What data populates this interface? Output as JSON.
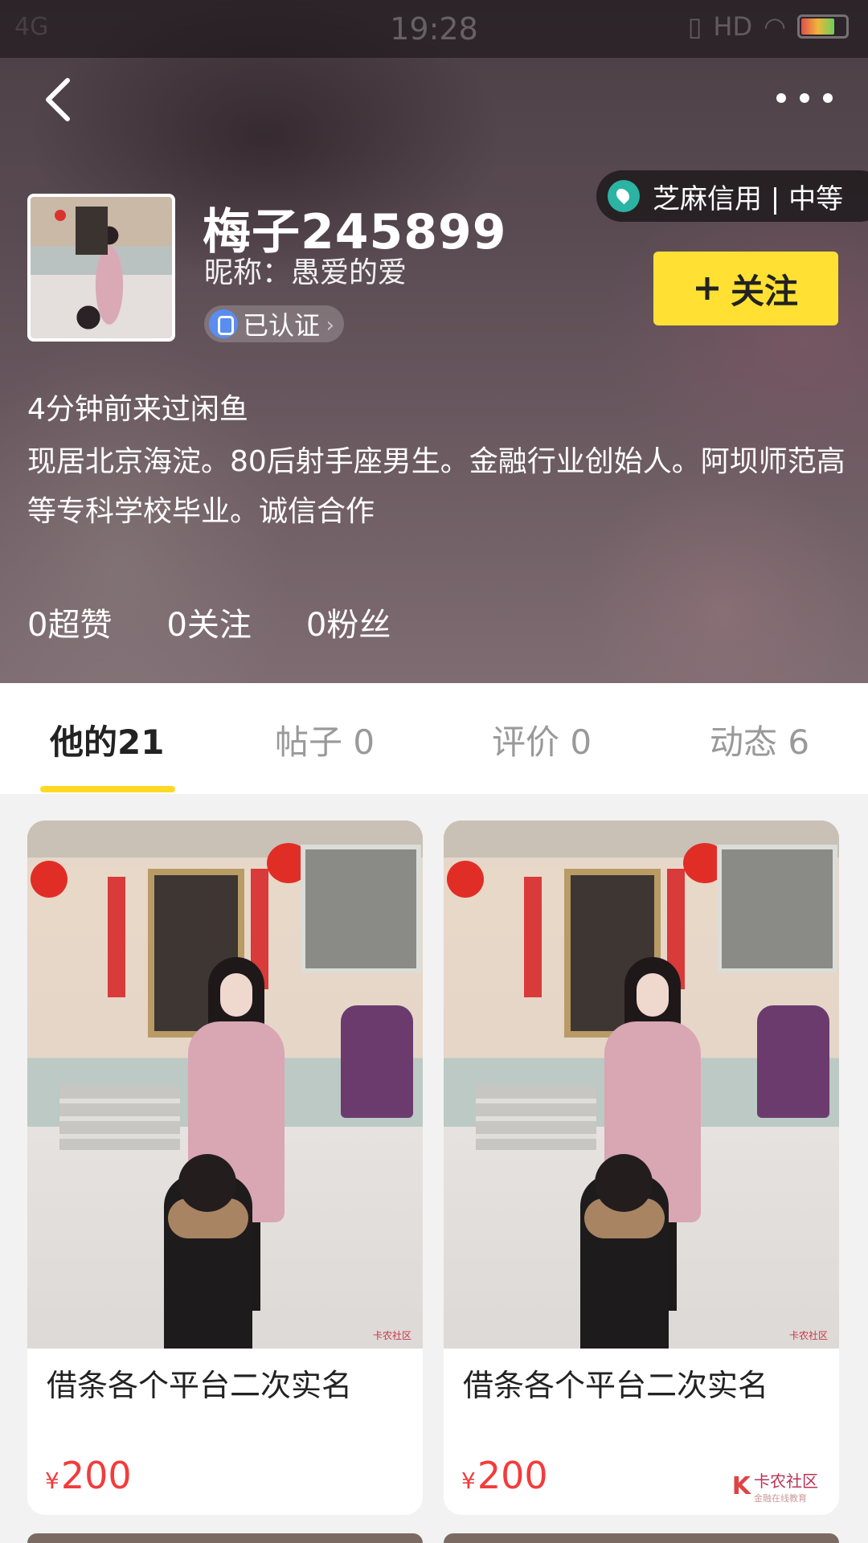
{
  "status_bar": {
    "network": "4G",
    "time": "19:28",
    "hd": "HD"
  },
  "header": {
    "username": "梅子245899",
    "nickname": "昵称：愚爱的爱",
    "verified_label": "已认证",
    "credit_label": "芝麻信用 | 中等",
    "follow_label": "关注",
    "last_visit": "4分钟前来过闲鱼",
    "bio": "现居北京海淀。80后射手座男生。金融行业创始人。阿坝师范高等专科学校毕业。诚信合作",
    "stats": [
      {
        "label": "0超赞"
      },
      {
        "label": "0关注"
      },
      {
        "label": "0粉丝"
      }
    ]
  },
  "tabs": [
    {
      "label": "他的21",
      "active": true
    },
    {
      "label": "帖子 0",
      "active": false
    },
    {
      "label": "评价 0",
      "active": false
    },
    {
      "label": "动态 6",
      "active": false
    }
  ],
  "items": [
    {
      "title": "借条各个平台二次实名",
      "currency": "¥",
      "price": "200",
      "watermark": "卡农社区"
    },
    {
      "title": "借条各个平台二次实名",
      "currency": "¥",
      "price": "200",
      "watermark": "卡农社区",
      "logo": "卡农社区",
      "logo_sub": "金融在线教育"
    }
  ],
  "colors": {
    "accent": "#ffe033",
    "price": "#f23c3c",
    "tab_indicator": "#ffd824"
  }
}
